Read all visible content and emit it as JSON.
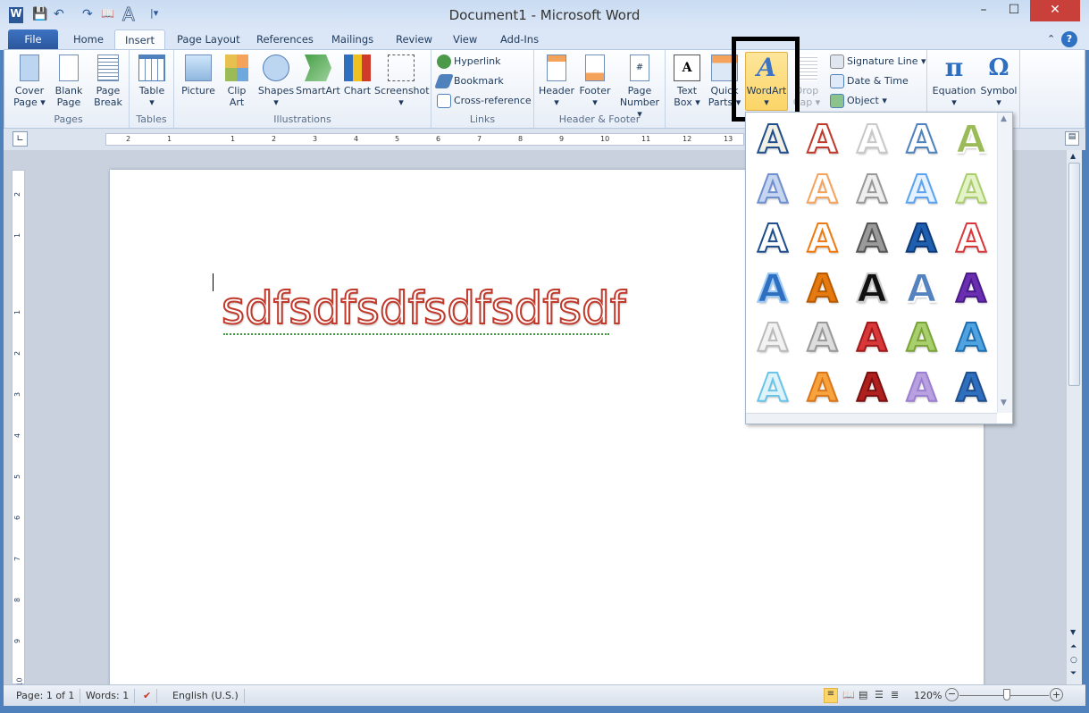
{
  "window": {
    "title": "Document1 - Microsoft Word",
    "minimize": "–",
    "maximize": "☐",
    "close": "✕"
  },
  "qat": {
    "app_icon": "W",
    "save": "💾",
    "undo": "↶",
    "redo": "↷",
    "font": "A"
  },
  "tabs": [
    "File",
    "Home",
    "Insert",
    "Page Layout",
    "References",
    "Mailings",
    "Review",
    "View",
    "Add-Ins"
  ],
  "ribbon": {
    "pages": {
      "label": "Pages",
      "cover": "Cover Page",
      "blank": "Blank Page",
      "break": "Page Break"
    },
    "tables": {
      "label": "Tables",
      "table": "Table"
    },
    "illustrations": {
      "label": "Illustrations",
      "picture": "Picture",
      "clipart": "Clip Art",
      "shapes": "Shapes",
      "smartart": "SmartArt",
      "chart": "Chart",
      "screenshot": "Screenshot"
    },
    "links": {
      "label": "Links",
      "hyperlink": "Hyperlink",
      "bookmark": "Bookmark",
      "crossref": "Cross-reference"
    },
    "headerfooter": {
      "label": "Header & Footer",
      "header": "Header",
      "footer": "Footer",
      "pagenumber": "Page Number"
    },
    "text": {
      "textbox": "Text Box",
      "quickparts": "Quick Parts",
      "wordart": "WordArt",
      "dropcap": "Drop Cap",
      "signature": "Signature Line",
      "datetime": "Date & Time",
      "object": "Object"
    },
    "symbols": {
      "equation": "Equation",
      "equation_glyph": "π",
      "symbol": "Symbol",
      "symbol_glyph": "Ω"
    }
  },
  "ruler": {
    "ticks": [
      "2",
      "1",
      "1",
      "2",
      "3",
      "4",
      "5",
      "6",
      "7",
      "8",
      "9",
      "10",
      "11",
      "12",
      "13"
    ],
    "vticks": [
      "2",
      "1",
      "1",
      "2",
      "3",
      "4",
      "5",
      "6",
      "7",
      "8",
      "9",
      "10"
    ]
  },
  "document": {
    "wordart_text": "sdfsdfsdfsdfsdfsdf"
  },
  "gallery": {
    "glyph": "A",
    "styles": [
      [
        "#f2efe4",
        "#1f4e8c"
      ],
      [
        "#fff",
        "#c0392b"
      ],
      [
        "#fff",
        "#c8c8c8"
      ],
      [
        "#fff",
        "#4f81bd"
      ],
      [
        "#9bbb59",
        "#ffffff"
      ],
      [
        "#c6d5f0",
        "#6f8fd0"
      ],
      [
        "#fff",
        "#f5a35a"
      ],
      [
        "#eee",
        "#999"
      ],
      [
        "#e6f2ff",
        "#5ba3f0"
      ],
      [
        "#e4f2c8",
        "#a9cf6d"
      ],
      [
        "#fff",
        "#1f4e8c"
      ],
      [
        "#fff",
        "#f07a10"
      ],
      [
        "#9a9a9a",
        "#555"
      ],
      [
        "#1f5fb0",
        "#0e3a7a"
      ],
      [
        "#fff",
        "#d9383a"
      ],
      [
        "#2f6fbf",
        "#9cc8f5"
      ],
      [
        "#e57a10",
        "#b85a00"
      ],
      [
        "#111",
        "#ccc"
      ],
      [
        "#5583c0",
        "#fff"
      ],
      [
        "#6a2fb0",
        "#4a1a8a"
      ],
      [
        "#f2f2f2",
        "#bbb"
      ],
      [
        "#ddd",
        "#999"
      ],
      [
        "#d9383a",
        "#a01818"
      ],
      [
        "#a9cf6d",
        "#7aa33a"
      ],
      [
        "#4fa3e0",
        "#1f6fb0"
      ],
      [
        "#dff3fb",
        "#6cc4e8"
      ],
      [
        "#f7a23c",
        "#d9761a"
      ],
      [
        "#b0201f",
        "#7a1010"
      ],
      [
        "#b9a0e0",
        "#9b7fd0"
      ],
      [
        "#2f6fbf",
        "#1f4e8c"
      ]
    ]
  },
  "status": {
    "page": "Page: 1 of 1",
    "words": "Words: 1",
    "language": "English (U.S.)",
    "zoom": "120%",
    "zoom_percent": 120
  }
}
